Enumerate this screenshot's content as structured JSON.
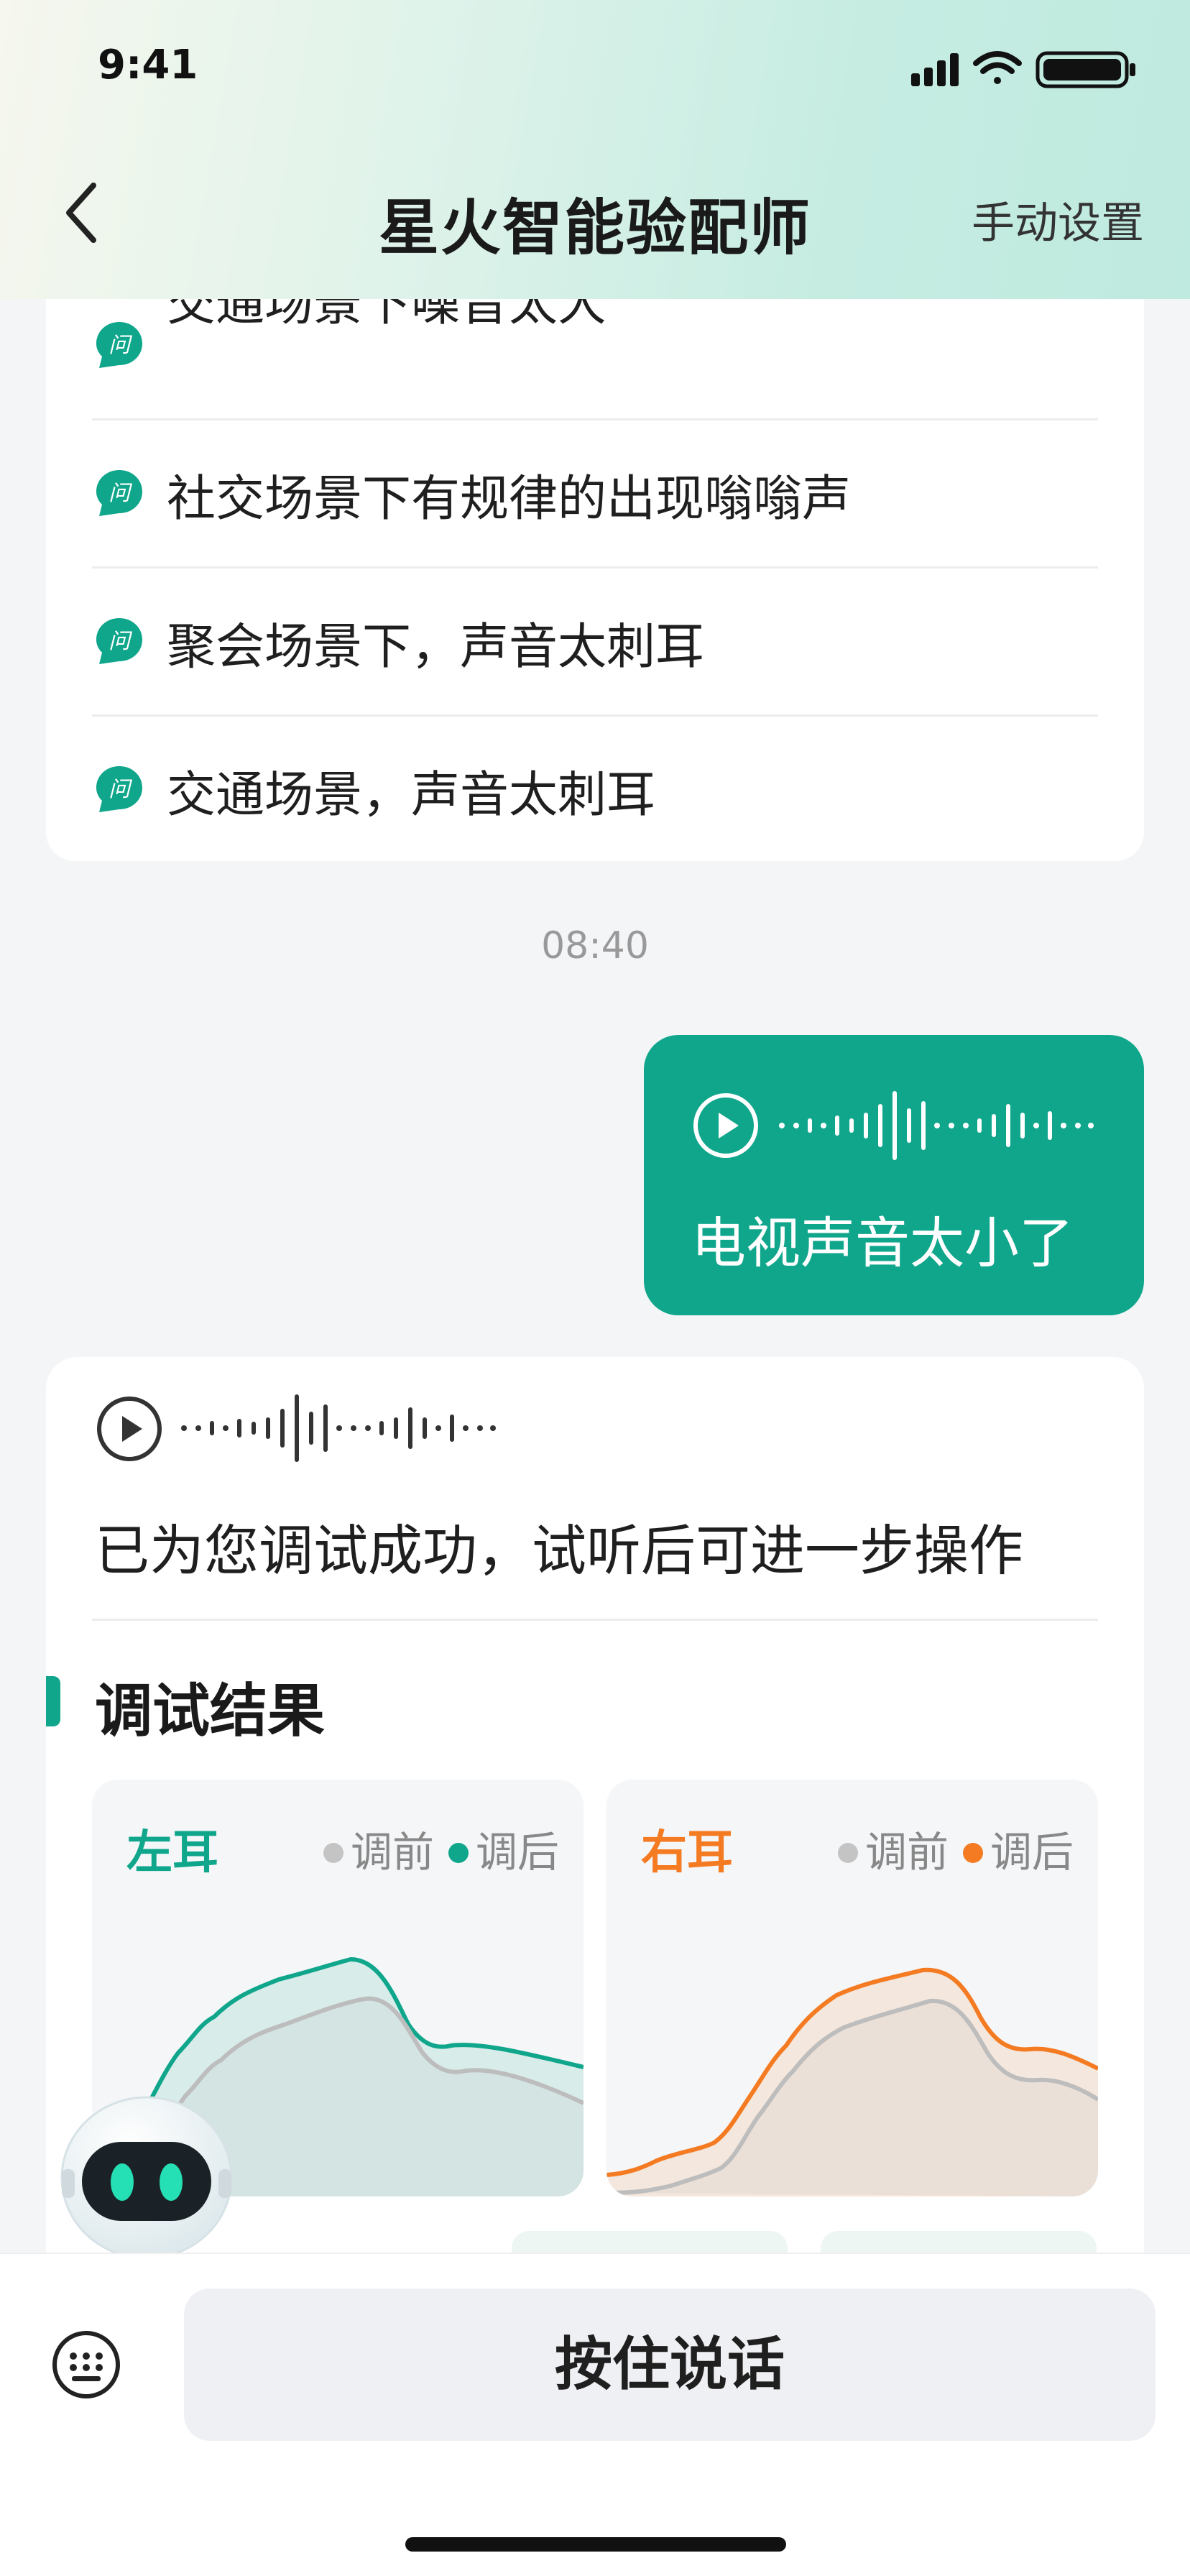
{
  "status": {
    "time": "9:41"
  },
  "nav": {
    "title": "星火智能验配师",
    "right_action": "手动设置"
  },
  "questions": [
    {
      "label": "交通场景下噪音太大"
    },
    {
      "label": "社交场景下有规律的出现嗡嗡声"
    },
    {
      "label": "聚会场景下，声音太刺耳"
    },
    {
      "label": "交通场景，声音太刺耳"
    }
  ],
  "question_icon_text": "问",
  "timestamp": "08:40",
  "user_message": {
    "text": "电视声音太小了"
  },
  "bot_message": {
    "text": "已为您调试成功，试听后可进一步操作",
    "section_title": "调试结果"
  },
  "left_ear": {
    "title": "左耳",
    "legend_before": "调前",
    "legend_after": "调后",
    "color_after": "#0fa68b",
    "color_before": "#bdbdbd"
  },
  "right_ear": {
    "title": "右耳",
    "legend_before": "调前",
    "legend_after": "调后",
    "color_after": "#f47b22",
    "color_before": "#bdbdbd"
  },
  "bottom": {
    "talk_button": "按住说话"
  },
  "colors": {
    "accent": "#0fa68b",
    "orange": "#f47b22"
  }
}
